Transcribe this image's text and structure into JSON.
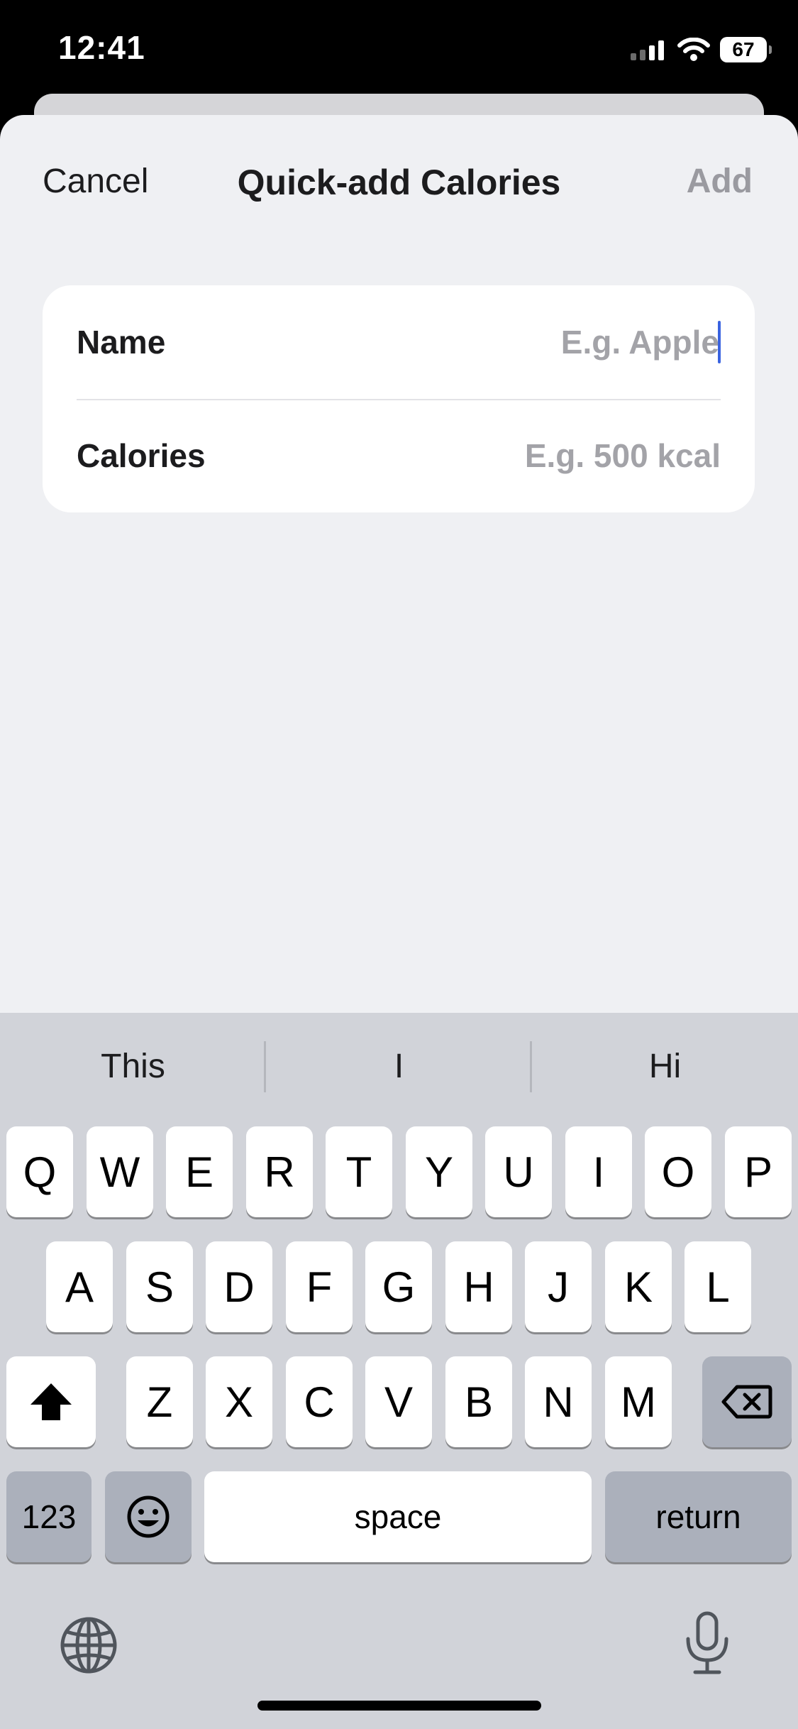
{
  "status_bar": {
    "time": "12:41",
    "battery": "67"
  },
  "nav": {
    "cancel": "Cancel",
    "title": "Quick-add Calories",
    "add": "Add"
  },
  "form": {
    "name_label": "Name",
    "name_placeholder": "E.g. Apple",
    "calories_label": "Calories",
    "calories_placeholder": "E.g. 500 kcal"
  },
  "keyboard": {
    "suggestions": [
      "This",
      "I",
      "Hi"
    ],
    "row1": [
      "Q",
      "W",
      "E",
      "R",
      "T",
      "Y",
      "U",
      "I",
      "O",
      "P"
    ],
    "row2": [
      "A",
      "S",
      "D",
      "F",
      "G",
      "H",
      "J",
      "K",
      "L"
    ],
    "row3": [
      "Z",
      "X",
      "C",
      "V",
      "B",
      "N",
      "M"
    ],
    "numbers_key": "123",
    "space_key": "space",
    "return_key": "return"
  },
  "icons": {
    "signal": "cellular-signal-icon",
    "wifi": "wifi-icon",
    "shift": "shift-icon",
    "delete": "delete-backspace-icon",
    "emoji": "emoji-icon",
    "globe": "globe-icon",
    "mic": "microphone-icon"
  }
}
